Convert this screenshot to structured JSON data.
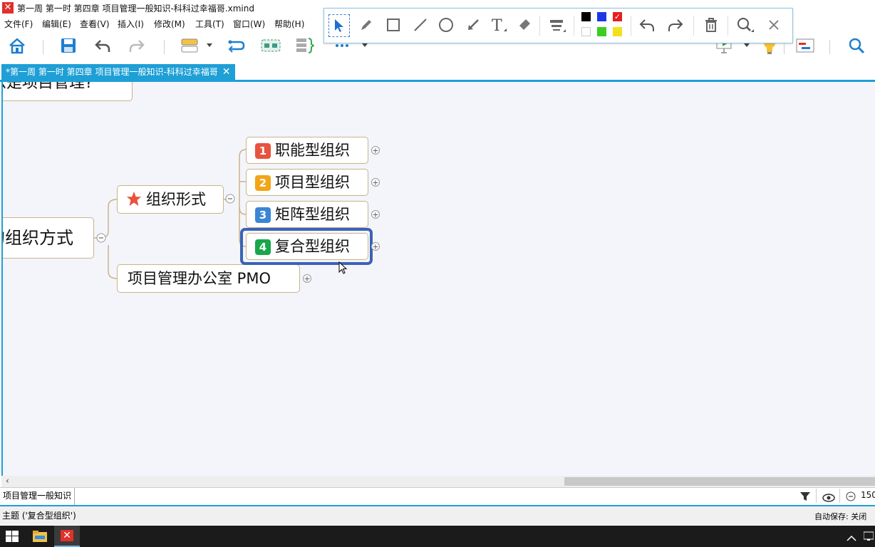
{
  "window": {
    "title": "第一周  第一时 第四章 项目管理一般知识-科科过幸福哥.xmind"
  },
  "menu": [
    "文件(F)",
    "编辑(E)",
    "查看(V)",
    "插入(I)",
    "修改(M)",
    "工具(T)",
    "窗口(W)",
    "帮助(H)"
  ],
  "tab": {
    "label": "*第一周  第一时 第四章 项目管理一般知识-科科过幸福哥",
    "close": "✕"
  },
  "mindmap": {
    "partial_top": "么是项目管理?",
    "partial_left": "的组织方式",
    "branch_main": "组织形式",
    "branch_pmo": "项目管理办公室  PMO",
    "children": [
      {
        "num": "1",
        "label": "职能型组织",
        "color": "#e8533e"
      },
      {
        "num": "2",
        "label": "项目型组织",
        "color": "#f2a516"
      },
      {
        "num": "3",
        "label": "矩阵型组织",
        "color": "#3a86d6"
      },
      {
        "num": "4",
        "label": "复合型组织",
        "color": "#1aa64b"
      }
    ]
  },
  "sheet": {
    "name": "项目管理一般知识",
    "zoom": "150"
  },
  "status": {
    "left": "主题 ('复合型组织')",
    "right": "自动保存: 关闭"
  },
  "colors": {
    "accent": "#1e9fd6",
    "selection": "#3a63b8"
  }
}
